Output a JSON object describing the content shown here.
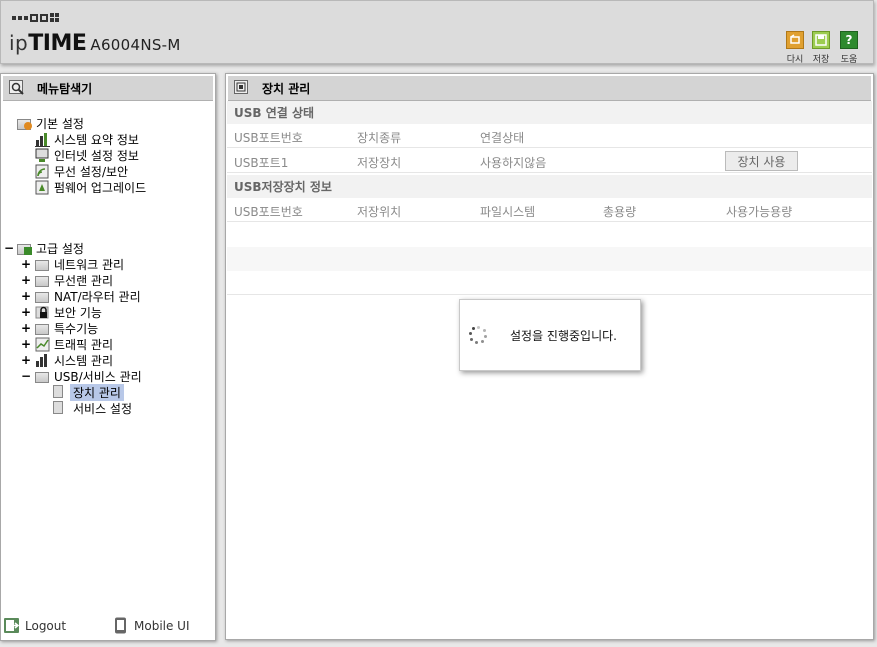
{
  "header": {
    "brand_ip": "ip",
    "brand_time": "TIME",
    "model": "A6004NS-M",
    "buttons": [
      {
        "label": "다시",
        "icon": "refresh-icon",
        "color": "#e0a030"
      },
      {
        "label": "저장",
        "icon": "save-icon",
        "color": "#8cc040"
      },
      {
        "label": "도움",
        "icon": "help-icon",
        "color": "#2e8a2e"
      }
    ]
  },
  "sidebar": {
    "title": "메뉴탐색기",
    "basic": {
      "label": "기본 설정",
      "items": [
        "시스템 요약 정보",
        "인터넷 설정 정보",
        "무선 설정/보안",
        "펌웨어 업그레이드"
      ]
    },
    "advanced": {
      "toggle": "−",
      "label": "고급 설정",
      "items": [
        {
          "toggle": "+",
          "label": "네트워크 관리"
        },
        {
          "toggle": "+",
          "label": "무선랜 관리"
        },
        {
          "toggle": "+",
          "label": "NAT/라우터 관리"
        },
        {
          "toggle": "+",
          "label": "보안 기능"
        },
        {
          "toggle": "+",
          "label": "특수기능"
        },
        {
          "toggle": "+",
          "label": "트래픽 관리"
        },
        {
          "toggle": "+",
          "label": "시스템 관리"
        },
        {
          "toggle": "−",
          "label": "USB/서비스 관리"
        }
      ],
      "usb_children": [
        "장치 관리",
        "서비스 설정"
      ]
    },
    "footer": {
      "logout": "Logout",
      "mobile": "Mobile UI"
    }
  },
  "main": {
    "title": "장치 관리",
    "usb_status": {
      "title": "USB 연결 상태",
      "headers": [
        "USB포트번호",
        "장치종류",
        "연결상태"
      ],
      "rows": [
        {
          "port": "USB포트1",
          "type": "저장장치",
          "status": "사용하지않음",
          "button": "장치 사용"
        }
      ]
    },
    "storage": {
      "title": "USB저장장치 정보",
      "headers": [
        "USB포트번호",
        "저장위치",
        "파일시스템",
        "총용량",
        "사용가능용량"
      ]
    },
    "dialog": {
      "message": "설정을 진행중입니다."
    }
  }
}
